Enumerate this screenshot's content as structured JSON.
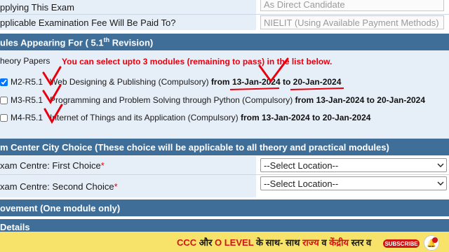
{
  "form": {
    "row1_label": "pplying This Exam",
    "row1_value": "As Direct Candidate",
    "row2_label": "pplicable Examination Fee Will Be Paid To?",
    "row2_value": "NIELIT (Using Available Payment Methods)"
  },
  "modules_section": {
    "title_prefix": "ules Appearing For ( 5.1",
    "title_sup": "th",
    "title_suffix": " Revision)",
    "papers_label": "heory Papers",
    "note": "You can select upto 3 modules (remaining to pass) in the list below.",
    "modules": [
      {
        "checked": true,
        "code": "M2-R5.1",
        "name": "Web Designing & Publishing (Compulsory)",
        "from_word": "from",
        "from_date": "13-Jan-2024",
        "to_word": "to",
        "to_date": "20-Jan-2024"
      },
      {
        "checked": false,
        "code": "M3-R5.1",
        "name": "Programming and Problem Solving through Python (Compulsory)",
        "from_word": "from",
        "from_date": "13-Jan-2024",
        "to_word": "to",
        "to_date": "20-Jan-2024"
      },
      {
        "checked": false,
        "code": "M4-R5.1",
        "name": "Internet of Things and its Application (Compulsory)",
        "from_word": "from",
        "from_date": "13-Jan-2024",
        "to_word": "to",
        "to_date": "20-Jan-2024"
      }
    ]
  },
  "centre_section": {
    "title": "m Center City Choice (These choice will be applicable to all theory and practical modules)",
    "first_label": "xam Centre: First Choice",
    "second_label": "xam Centre: Second Choice",
    "required_mark": "*",
    "select_placeholder": "--Select Location--"
  },
  "improvement_section": {
    "title": "ovement (One module only)"
  },
  "details_section": {
    "title": "Details"
  },
  "banner": {
    "part1": "CCC",
    "part2": " और ",
    "part3": "O LEVEL",
    "part4": " के साथ- साथ ",
    "part5": "राज्य",
    "part6": " व ",
    "part7": "केंद्रीय",
    "part8": " स्तर व",
    "subscribe": "SUBSCRIBE"
  },
  "colors": {
    "section_bar": "#3f6f99",
    "label_bg": "#e6eef8",
    "note_red": "#e8000e",
    "banner_bg": "#f7e36a",
    "check_marks": "#e8000e"
  },
  "icons": {
    "dropdown": "chevron-down-icon",
    "bell": "bell-icon"
  }
}
